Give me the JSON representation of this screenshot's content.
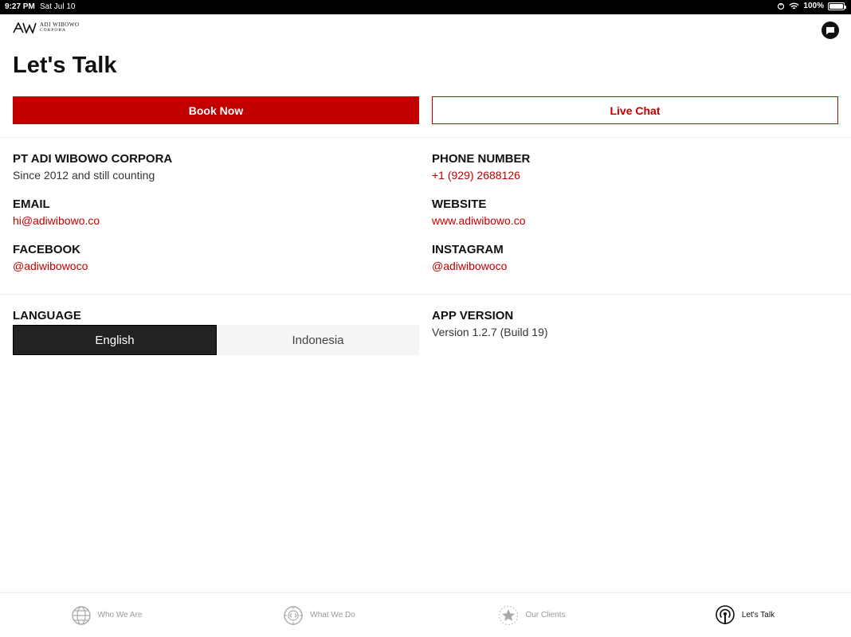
{
  "status_bar": {
    "time": "9:27 PM",
    "date": "Sat Jul 10",
    "battery": "100%"
  },
  "logo": {
    "line1": "ADI WIBOWO",
    "line2": "CORPORA"
  },
  "page": {
    "title": "Let's Talk"
  },
  "buttons": {
    "book": "Book Now",
    "chat": "Live Chat"
  },
  "info": {
    "company": {
      "label": "PT ADI WIBOWO CORPORA",
      "value": "Since 2012 and still counting"
    },
    "phone": {
      "label": "PHONE NUMBER",
      "value": "+1 (929) 2688126"
    },
    "email": {
      "label": "EMAIL",
      "value": "hi@adiwibowo.co"
    },
    "website": {
      "label": "WEBSITE",
      "value": "www.adiwibowo.co"
    },
    "facebook": {
      "label": "FACEBOOK",
      "value": "@adiwibowoco"
    },
    "instagram": {
      "label": "INSTAGRAM",
      "value": "@adiwibowoco"
    }
  },
  "language": {
    "label": "LANGUAGE",
    "options": [
      "English",
      "Indonesia"
    ],
    "selected": "English"
  },
  "app_version": {
    "label": "APP VERSION",
    "value": "Version 1.2.7 (Build 19)"
  },
  "tabs": [
    {
      "label": "Who We Are",
      "icon": "globe-icon"
    },
    {
      "label": "What We Do",
      "icon": "code-compass-icon"
    },
    {
      "label": "Our Clients",
      "icon": "star-badge-icon"
    },
    {
      "label": "Let's Talk",
      "icon": "broadcast-icon"
    }
  ],
  "active_tab": "Let's Talk",
  "colors": {
    "accent": "#c20000",
    "dark": "#222222"
  }
}
